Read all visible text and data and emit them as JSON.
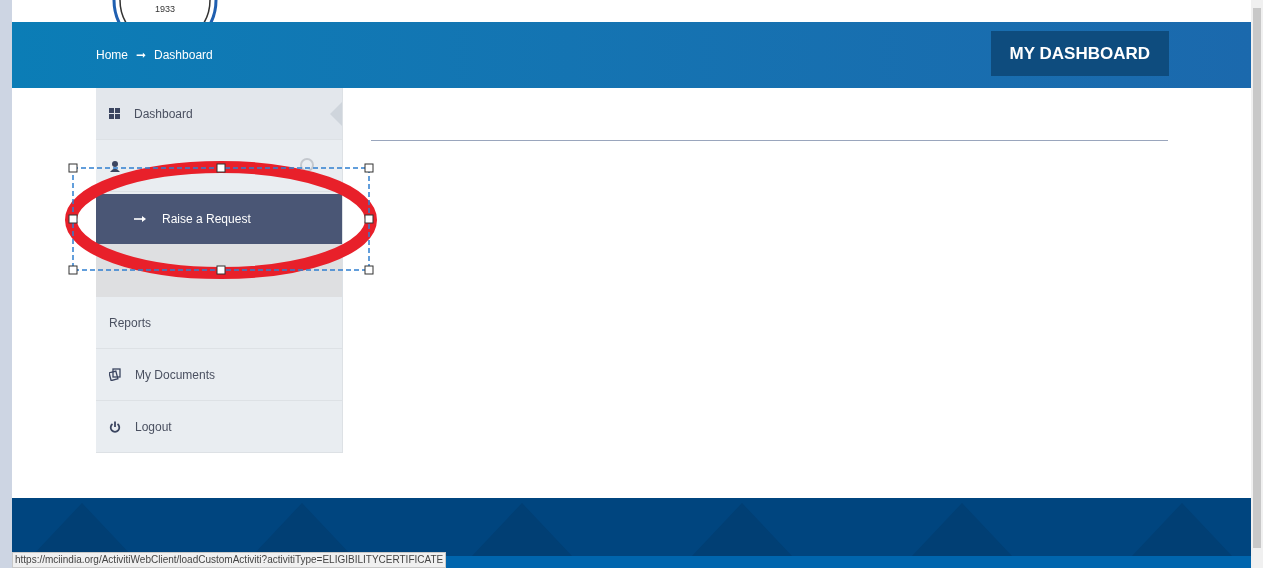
{
  "header": {
    "seal_text": "1933",
    "breadcrumb": [
      "Home",
      "Dashboard"
    ],
    "breadcrumb_separator": "➞",
    "title": "MY DASHBOARD"
  },
  "sidebar": {
    "items": [
      {
        "kind": "link",
        "label": "Dashboard",
        "selected": true
      },
      {
        "kind": "expandable",
        "selected": false
      },
      {
        "kind": "subitem",
        "label": "Raise a Request",
        "selected": false
      },
      {
        "kind": "blank",
        "selected": false
      },
      {
        "kind": "link",
        "label": "Reports",
        "selected": false
      },
      {
        "kind": "link",
        "label": "My Documents",
        "selected": false
      },
      {
        "kind": "link",
        "label": "Logout",
        "selected": false
      }
    ]
  },
  "status_bar": {
    "url": "https://mciindia.org/ActivitiWebClient/loadCustomActiviti?activitiType=ELIGIBILITYCERTIFICATE"
  }
}
